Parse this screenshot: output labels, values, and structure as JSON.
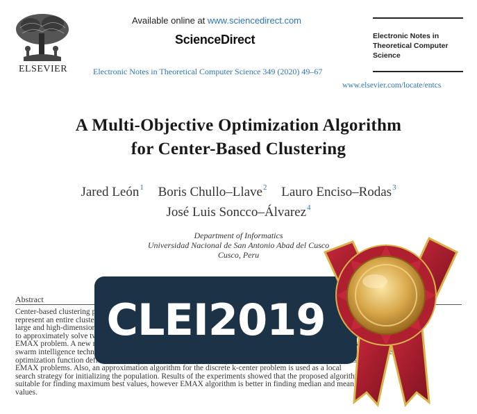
{
  "header": {
    "publisher": "ELSEVIER",
    "available_prefix": "Available online at ",
    "available_url": "www.sciencedirect.com",
    "brand": "ScienceDirect",
    "citation": "Electronic Notes in Theoretical Computer Science 349 (2020) 49–67",
    "journal_title_lines": [
      "Electronic Notes in",
      "Theoretical Computer",
      "Science"
    ],
    "journal_url": "www.elsevier.com/locate/entcs"
  },
  "paper": {
    "title_line1": "A Multi-Objective Optimization Algorithm",
    "title_line2": "for Center-Based Clustering",
    "authors": [
      {
        "name": "Jared León",
        "aff": "1"
      },
      {
        "name": "Boris Chullo–Llave",
        "aff": "2"
      },
      {
        "name": "Lauro Enciso–Rodas",
        "aff": "3"
      },
      {
        "name": "José Luis Soncco–Álvarez",
        "aff": "4"
      }
    ],
    "affiliation": {
      "department": "Department of Informatics",
      "university": "Universidad Nacional de San Antonio Abad del Cusco",
      "location": "Cusco, Peru"
    }
  },
  "abstract": {
    "heading": "Abstract",
    "lines": [
      "Center-based clustering problems aim to find k centers that minimize an objective over a set of points, choosing the center, to",
      "represent an entire cluster. The problem has applications in many fields, in particular in the analysis of clustering",
      "large and high-dimensional data. In this work we propose a multi-objective approach, an evolutionary algorithm",
      "to approximately solve two clustering problems, the k-center problem and the k-means problem, and namely the",
      "EMAX problem. A new metaheuristic is proposed for solving these center-based clustering problems; it is based on a",
      "swarm intelligence technique and it optimizes both objectives using a multi-objective approach. We define a multi-objective",
      "optimization function defined as a weighted combination of the objective functions of the k-center, k-means and",
      "EMAX problems. Also, an approximation algorithm for the discrete k-center problem is used as a local",
      "search strategy for initializing the population. Results of the experiments showed that the proposed algorithm is",
      "suitable for finding maximum best values, however EMAX algorithm is better in finding median and mean",
      "values."
    ]
  },
  "overlay": {
    "banner_text": "CLEI2019",
    "banner_color": "#1c3347",
    "medal_gold": "#d4a64a",
    "ribbon_red": "#a51c2b"
  }
}
